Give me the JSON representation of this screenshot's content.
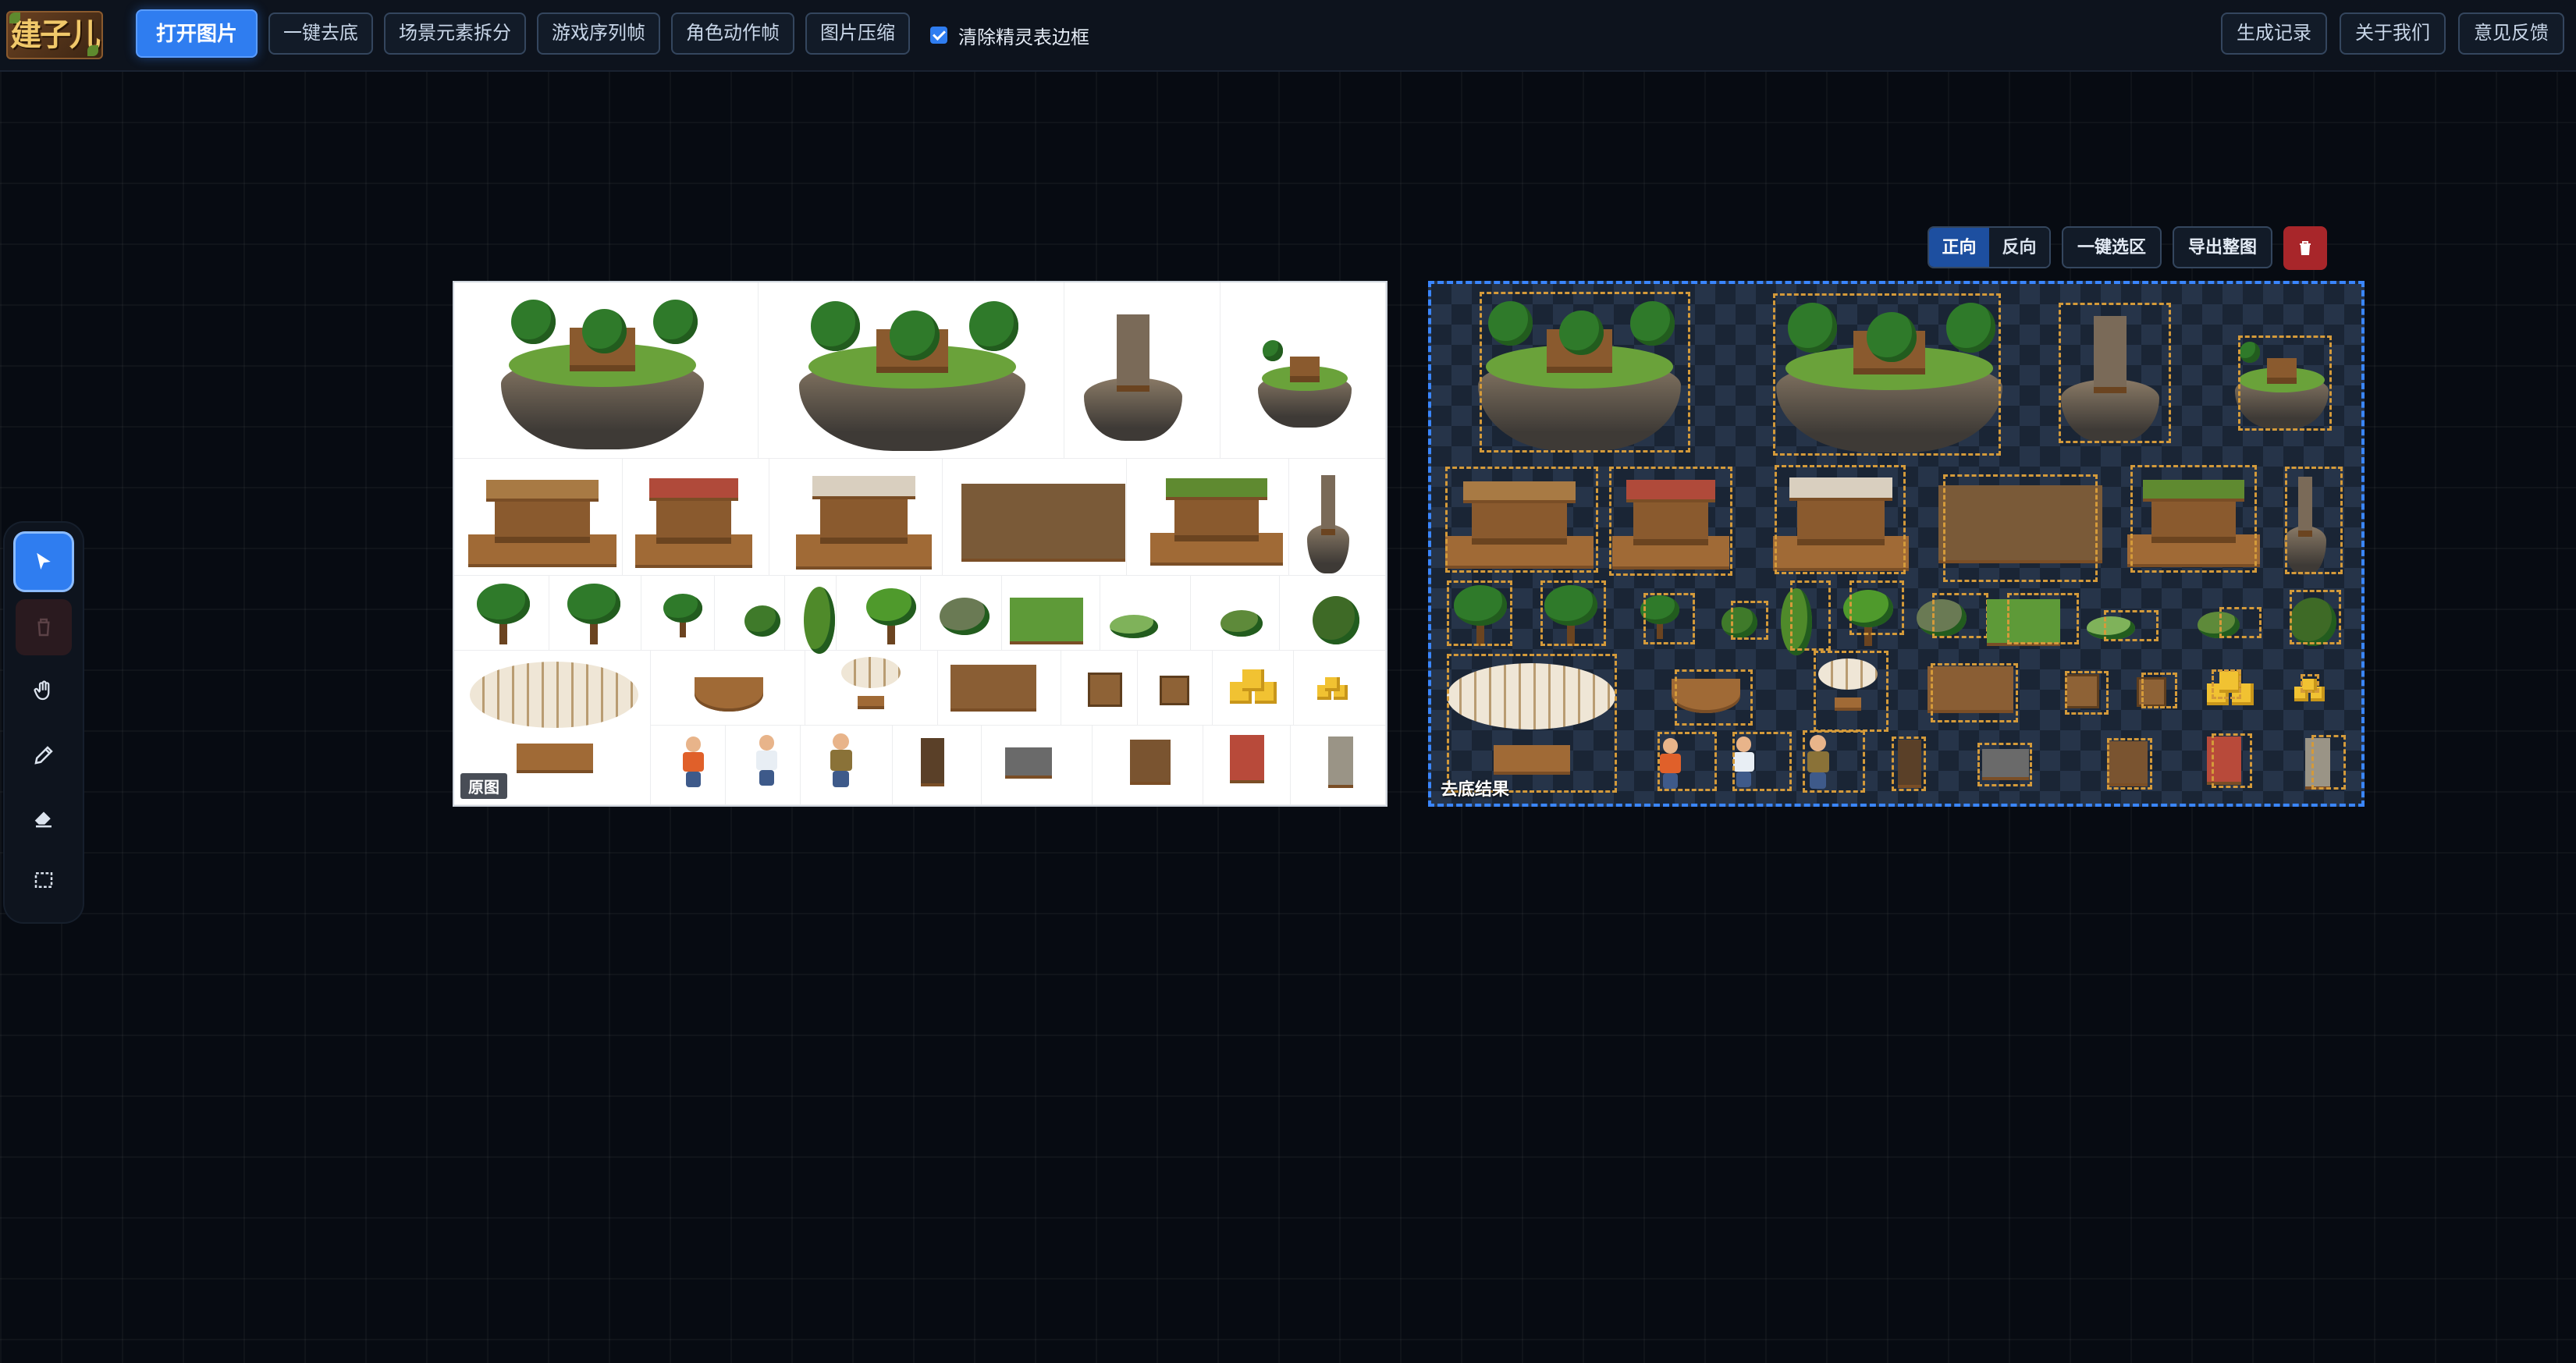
{
  "app": {
    "logo_text": "建子儿"
  },
  "topbar": {
    "open_image": "打开图片",
    "tools": [
      "一键去底",
      "场景元素拆分",
      "游戏序列帧",
      "角色动作帧",
      "图片压缩"
    ],
    "clear_border_label": "清除精灵表边框",
    "clear_border_checked": true,
    "right": [
      "生成记录",
      "关于我们",
      "意见反馈"
    ]
  },
  "toolbar": {
    "tools": [
      {
        "name": "select",
        "icon": "pointer-icon",
        "state": "active"
      },
      {
        "name": "delete",
        "icon": "trash-icon",
        "state": "disabled"
      },
      {
        "name": "pan",
        "icon": "hand-icon",
        "state": "normal"
      },
      {
        "name": "brush",
        "icon": "pencil-icon",
        "state": "normal"
      },
      {
        "name": "eraser",
        "icon": "eraser-icon",
        "state": "normal"
      },
      {
        "name": "marquee",
        "icon": "marquee-select-icon",
        "state": "normal"
      }
    ]
  },
  "result_actions": {
    "direction": [
      "正向",
      "反向"
    ],
    "direction_selected": "正向",
    "select_all": "一键选区",
    "export": "导出整图",
    "delete_icon": "trash-icon"
  },
  "panels": {
    "original_label": "原图",
    "result_label": "去底结果"
  },
  "colors": {
    "accent": "#2f7df0",
    "danger": "#a8262a",
    "selection": "#d49a3a"
  }
}
